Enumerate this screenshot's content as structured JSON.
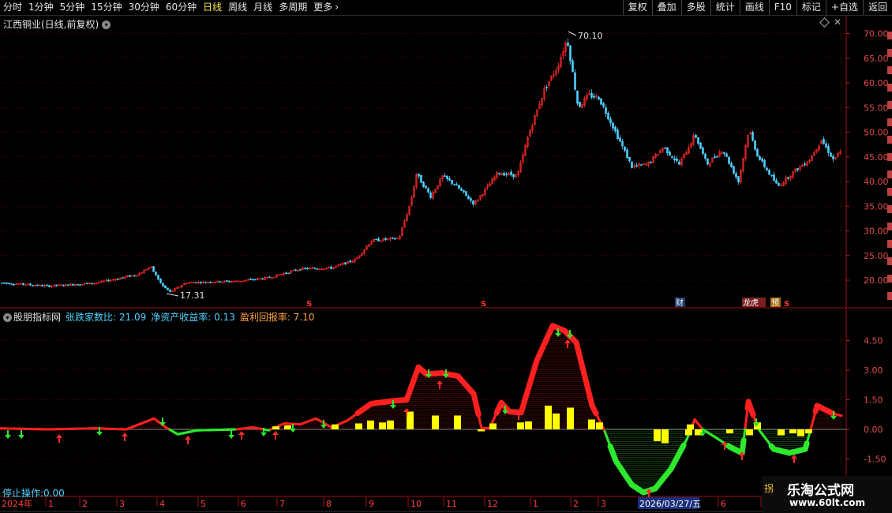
{
  "toolbar": {
    "period_tabs": [
      {
        "label": "分时",
        "active": false
      },
      {
        "label": "1分钟",
        "active": false
      },
      {
        "label": "5分钟",
        "active": false
      },
      {
        "label": "15分钟",
        "active": false
      },
      {
        "label": "30分钟",
        "active": false
      },
      {
        "label": "60分钟",
        "active": false
      },
      {
        "label": "日线",
        "active": true
      },
      {
        "label": "周线",
        "active": false
      },
      {
        "label": "月线",
        "active": false
      },
      {
        "label": "多周期",
        "active": false
      },
      {
        "label": "更多",
        "active": false
      }
    ],
    "more_arrow": "›",
    "right_buttons": [
      "复权",
      "叠加",
      "多股",
      "统计",
      "画线",
      "F10",
      "标记",
      "+自选",
      "返回"
    ]
  },
  "price_panel": {
    "title": "江西铜业(日线,前复权)",
    "y_ticks": [
      "70.00",
      "65.00",
      "60.00",
      "55.00",
      "50.00",
      "45.00",
      "40.00",
      "35.00",
      "30.00",
      "25.00",
      "20.00"
    ],
    "max_label": "70.10",
    "min_label": "17.31",
    "event_markers": [
      "财",
      "龙虎",
      "预",
      "S",
      "S",
      "S"
    ]
  },
  "indicator_panel": {
    "name": "股朋指标网",
    "field1_label": "张跌家数比:",
    "field1_value": "21.09",
    "field2": "净资产收益率: 0.13",
    "field3": "盈利回报率: 7.10",
    "y_ticks": [
      "4.50",
      "3.00",
      "1.50",
      "0.00",
      "-1.50"
    ]
  },
  "status": {
    "stop_operation": "停止操作:0.00"
  },
  "timeline": {
    "year_label": "2024年",
    "months": [
      "1",
      "2",
      "3",
      "4",
      "5",
      "6",
      "7",
      "8",
      "9",
      "10",
      "11",
      "12",
      "1",
      "2",
      "3",
      "6",
      "7"
    ],
    "highlight_date": "2026/03/27/五"
  },
  "watermark": {
    "char": "拐",
    "title": "乐淘公式网",
    "url": "www.60lt.com"
  },
  "colors": {
    "up": "#ff2a2a",
    "down": "#4fd2ff",
    "ind_positive": "#ff2020",
    "ind_negative": "#2ee82e",
    "bar": "#ffff00",
    "grid": "#5a0000"
  }
}
